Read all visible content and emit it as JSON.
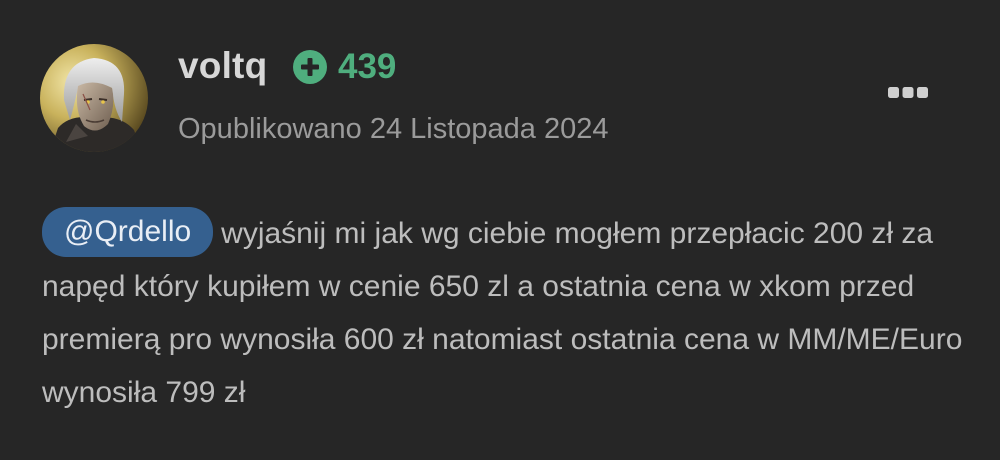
{
  "author": {
    "name": "voltq",
    "avatar_icon": "witcher-avatar-icon",
    "reputation": {
      "icon": "plus-circle-icon",
      "value": "439",
      "color": "#4fae7e"
    }
  },
  "post": {
    "date_text": "Opublikowano 24 Listopada 2024",
    "mention": "@Qrdello",
    "body": "wyjaśnij mi jak wg ciebie mogłem przepłacic 200 zł za napęd który kupiłem w cenie 650 zl a ostatnia cena w xkom przed premierą pro wynosiła 600 zł natomiast ostatnia cena w MM/ME/Euro wynosiła 799 zł"
  },
  "actions": {
    "more_icon": "more-dots-icon"
  },
  "colors": {
    "background": "#262626",
    "mention_bg": "#35608f",
    "text": "#bdbdbd",
    "muted": "#9b9b9b"
  }
}
